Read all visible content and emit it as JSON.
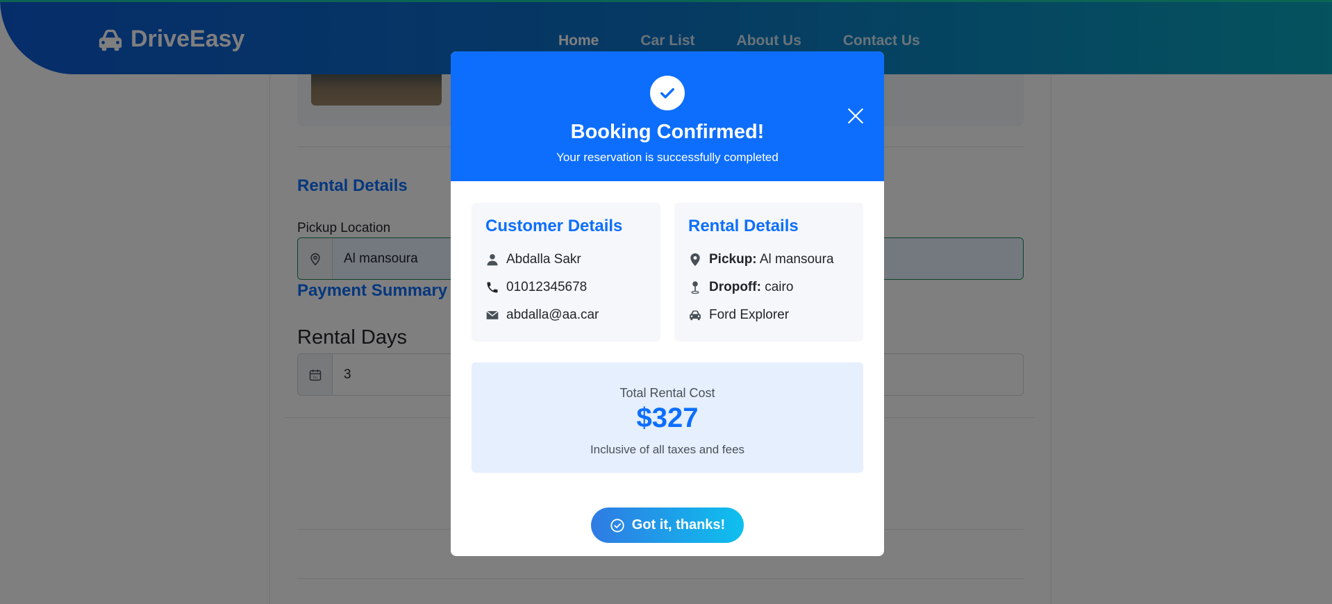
{
  "nav": {
    "brand": "DriveEasy",
    "links": [
      "Home",
      "Car List",
      "About Us",
      "Contact Us"
    ]
  },
  "form": {
    "rental_section_title": "Rental Details",
    "pickup_label": "Pickup Location",
    "pickup_value": "Al mansoura",
    "payment_section_title": "Payment Summary",
    "rental_days_label": "Rental Days",
    "rental_days_value": "3",
    "calendar_day_abbr": "Fri"
  },
  "modal": {
    "title": "Booking Confirmed!",
    "subtitle": "Your reservation is successfully completed",
    "customer": {
      "title": "Customer Details",
      "name": "Abdalla Sakr",
      "phone": "01012345678",
      "email": "abdalla@aa.car"
    },
    "rental": {
      "title": "Rental Details",
      "pickup_label": "Pickup:",
      "pickup_value": "Al mansoura",
      "dropoff_label": "Dropoff:",
      "dropoff_value": "cairo",
      "car": "Ford Explorer"
    },
    "cost": {
      "label": "Total Rental Cost",
      "value": "$327",
      "note": "Inclusive of all taxes and fees"
    },
    "confirm_button": "Got it, thanks!"
  },
  "colors": {
    "primary": "#0d6efd",
    "nav_gradient_start": "#0d5bd4",
    "nav_gradient_end": "#0aa6bd",
    "cost_bg": "#e5effd",
    "card_bg": "#f5f7fa"
  },
  "icons": [
    "car-icon",
    "map-pin-outline-icon",
    "calendar-icon",
    "check-icon",
    "close-icon",
    "user-icon",
    "phone-icon",
    "envelope-icon",
    "map-pin-icon",
    "pin-icon",
    "car-front-icon",
    "check-circle-icon"
  ]
}
